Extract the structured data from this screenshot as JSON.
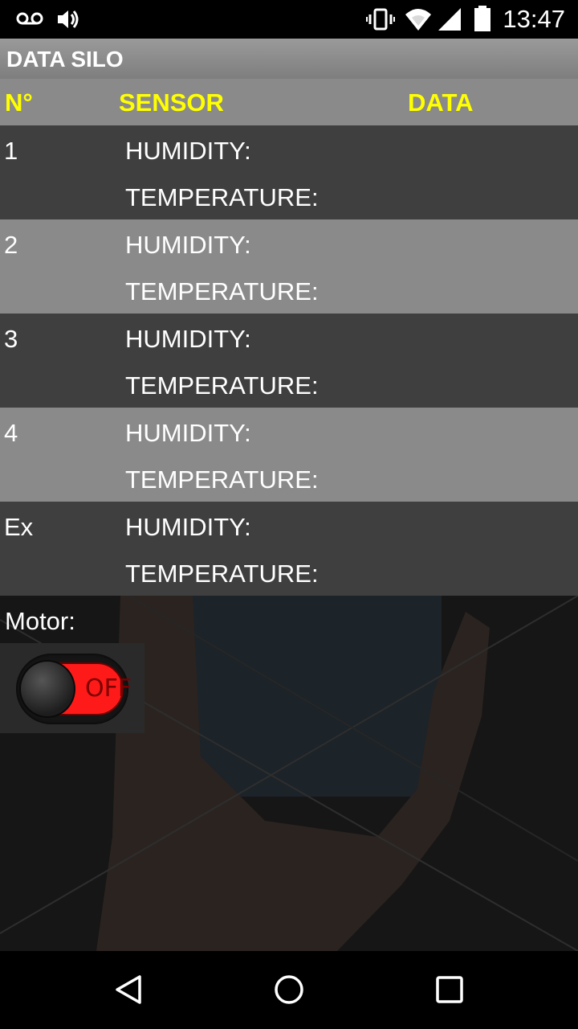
{
  "status_bar": {
    "time": "13:47",
    "icons": [
      "voicemail-icon",
      "volume-icon",
      "vibrate-icon",
      "wifi-icon",
      "signal-icon",
      "battery-icon"
    ]
  },
  "app": {
    "title": "DATA SILO"
  },
  "table": {
    "headers": {
      "no": "N°",
      "sensor": "SENSOR",
      "data": "DATA"
    },
    "rows": [
      {
        "id": "1",
        "humidity_label": "HUMIDITY:",
        "temperature_label": "TEMPERATURE:"
      },
      {
        "id": "2",
        "humidity_label": "HUMIDITY:",
        "temperature_label": "TEMPERATURE:"
      },
      {
        "id": "3",
        "humidity_label": "HUMIDITY:",
        "temperature_label": "TEMPERATURE:"
      },
      {
        "id": "4",
        "humidity_label": "HUMIDITY:",
        "temperature_label": "TEMPERATURE:"
      },
      {
        "id": "Ex",
        "humidity_label": "HUMIDITY:",
        "temperature_label": "TEMPERATURE:"
      }
    ]
  },
  "motor": {
    "label": "Motor:",
    "switch_state": "OFF"
  },
  "colors": {
    "header_text": "#ffff00",
    "row_dark": "#3f3f3f",
    "row_light": "#8a8a8a",
    "switch_off": "#ff1a1a"
  },
  "nav": {
    "icons": [
      "back-icon",
      "home-icon",
      "recents-icon"
    ]
  }
}
